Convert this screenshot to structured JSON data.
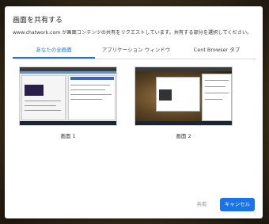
{
  "dialog": {
    "title": "画面を共有する",
    "subtitle": "www.chatwork.com が画面コンテンツの共有をリクエストしています。共有する部分を選択してください。"
  },
  "tabs": [
    {
      "label": "あなたの全画面",
      "active": true
    },
    {
      "label": "アプリケーション ウィンドウ",
      "active": false
    },
    {
      "label": "Cent Browser タブ",
      "active": false
    }
  ],
  "screens": [
    {
      "label": "画面 1"
    },
    {
      "label": "画面 2"
    }
  ],
  "buttons": {
    "share": "共有",
    "cancel": "キャンセル"
  },
  "colors": {
    "accent": "#1a73e8"
  }
}
